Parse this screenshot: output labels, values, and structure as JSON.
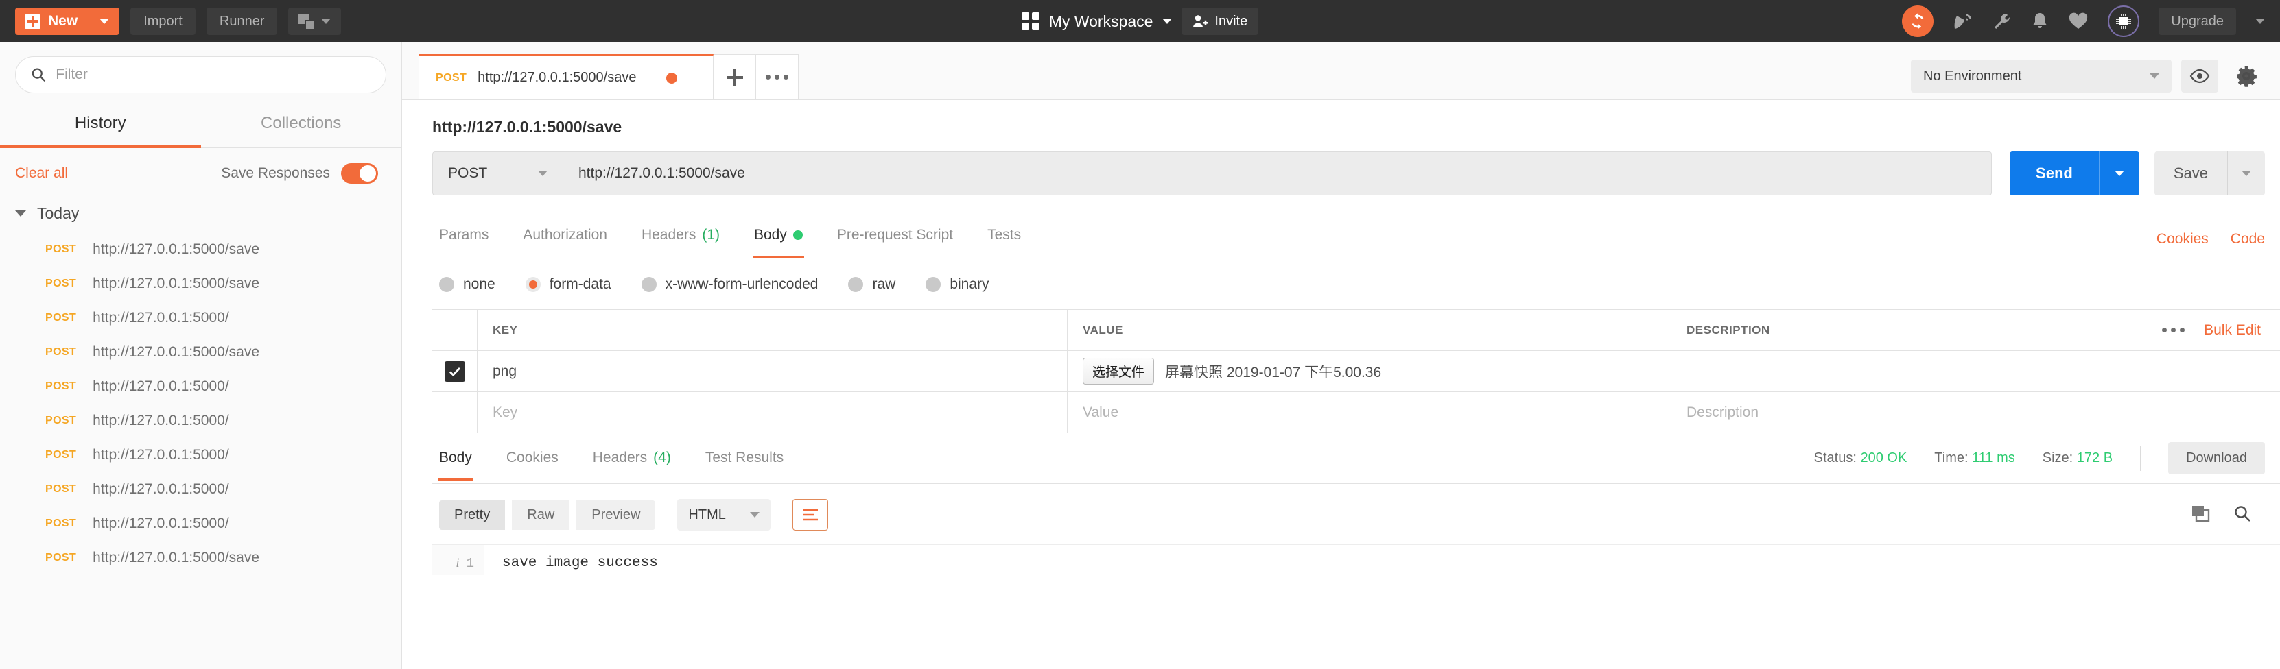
{
  "topbar": {
    "new_label": "New",
    "import_label": "Import",
    "runner_label": "Runner",
    "workspace_label": "My Workspace",
    "invite_label": "Invite",
    "upgrade_label": "Upgrade",
    "icons": {
      "new_plus": "plus-icon",
      "new_caret": "chevron-down-icon",
      "new_window": "new-window-icon",
      "workspace_grid": "grid-icon",
      "invite_person": "person-add-icon",
      "sync": "sync-icon",
      "satellite": "satellite-icon",
      "wrench": "wrench-icon",
      "bell": "bell-icon",
      "heart": "heart-icon",
      "chip": "chip-icon"
    },
    "accent_orange": "#f26b3a",
    "bar_bg": "#303030"
  },
  "sidebar": {
    "filter_placeholder": "Filter",
    "filter_value": "",
    "tabs": [
      {
        "label": "History",
        "active": true
      },
      {
        "label": "Collections",
        "active": false
      }
    ],
    "clear_all_label": "Clear all",
    "save_responses_label": "Save Responses",
    "save_responses_on": true,
    "group_label": "Today",
    "items": [
      {
        "method": "POST",
        "url": "http://127.0.0.1:5000/save"
      },
      {
        "method": "POST",
        "url": "http://127.0.0.1:5000/save"
      },
      {
        "method": "POST",
        "url": "http://127.0.0.1:5000/"
      },
      {
        "method": "POST",
        "url": "http://127.0.0.1:5000/save"
      },
      {
        "method": "POST",
        "url": "http://127.0.0.1:5000/"
      },
      {
        "method": "POST",
        "url": "http://127.0.0.1:5000/"
      },
      {
        "method": "POST",
        "url": "http://127.0.0.1:5000/"
      },
      {
        "method": "POST",
        "url": "http://127.0.0.1:5000/"
      },
      {
        "method": "POST",
        "url": "http://127.0.0.1:5000/"
      },
      {
        "method": "POST",
        "url": "http://127.0.0.1:5000/save"
      }
    ]
  },
  "tabbar": {
    "request_tab": {
      "method": "POST",
      "url": "http://127.0.0.1:5000/save",
      "unsaved": true
    },
    "environment_value": "No Environment",
    "icons": {
      "add_tab": "plus-icon",
      "tab_menu": "ellipsis-icon",
      "eye": "eye-icon",
      "gear": "gear-icon"
    }
  },
  "request": {
    "title": "http://127.0.0.1:5000/save",
    "method": "POST",
    "url_value": "http://127.0.0.1:5000/save",
    "send_label": "Send",
    "save_label": "Save",
    "tabs": [
      {
        "label": "Params",
        "active": false
      },
      {
        "label": "Authorization",
        "active": false
      },
      {
        "label": "Headers",
        "count": "(1)",
        "active": false
      },
      {
        "label": "Body",
        "active": true,
        "dot": true
      },
      {
        "label": "Pre-request Script",
        "active": false
      },
      {
        "label": "Tests",
        "active": false
      }
    ],
    "cookies_label": "Cookies",
    "code_label": "Code",
    "body_types": [
      {
        "label": "none",
        "selected": false
      },
      {
        "label": "form-data",
        "selected": true
      },
      {
        "label": "x-www-form-urlencoded",
        "selected": false
      },
      {
        "label": "raw",
        "selected": false
      },
      {
        "label": "binary",
        "selected": false
      }
    ],
    "table": {
      "headers": {
        "key": "KEY",
        "value": "VALUE",
        "description": "DESCRIPTION"
      },
      "bulk_edit_label": "Bulk Edit",
      "rows": [
        {
          "checked": true,
          "key": "png",
          "file_button": "选择文件",
          "file_name": "屏幕快照 2019-01-07 下午5.00.36",
          "description": ""
        }
      ],
      "placeholder_row": {
        "key": "Key",
        "value": "Value",
        "description": "Description"
      }
    }
  },
  "response": {
    "tabs": [
      {
        "label": "Body",
        "active": true
      },
      {
        "label": "Cookies",
        "active": false
      },
      {
        "label": "Headers",
        "count": "(4)",
        "active": false
      },
      {
        "label": "Test Results",
        "active": false
      }
    ],
    "status_label": "Status:",
    "status_value": "200 OK",
    "time_label": "Time:",
    "time_value": "111 ms",
    "size_label": "Size:",
    "size_value": "172 B",
    "download_label": "Download",
    "view_modes": [
      {
        "label": "Pretty",
        "active": true
      },
      {
        "label": "Raw",
        "active": false
      },
      {
        "label": "Preview",
        "active": false
      }
    ],
    "format_value": "HTML",
    "icons": {
      "wrap": "wrap-lines-icon",
      "copy": "copy-icon",
      "search": "search-icon"
    },
    "lines": [
      {
        "num": "1",
        "text": "save image success"
      }
    ]
  }
}
